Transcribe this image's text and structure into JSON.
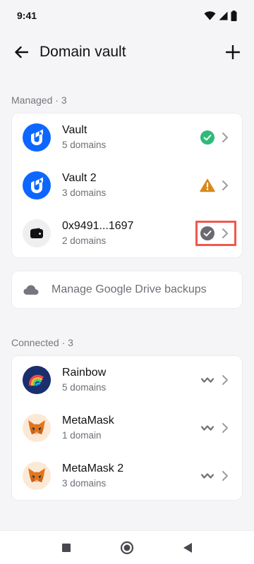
{
  "status_bar": {
    "time": "9:41"
  },
  "header": {
    "title": "Domain vault"
  },
  "managed": {
    "section_label": "Managed · 3",
    "items": [
      {
        "title": "Vault",
        "subtitle": "5 domains",
        "avatar_icon": "ud-logo-icon",
        "status_icon": "check-circle-icon",
        "status_color": "#2fba79"
      },
      {
        "title": "Vault 2",
        "subtitle": "3 domains",
        "avatar_icon": "ud-logo-icon",
        "status_icon": "warning-triangle-icon",
        "status_color": "#d9891a"
      },
      {
        "title": "0x9491...1697",
        "subtitle": "2 domains",
        "avatar_icon": "wallet-icon",
        "status_icon": "check-circle-icon",
        "status_color": "#6b6a72"
      }
    ]
  },
  "backup": {
    "label": "Manage Google Drive backups",
    "icon": "cloud-icon"
  },
  "connected": {
    "section_label": "Connected · 3",
    "items": [
      {
        "title": "Rainbow",
        "subtitle": "5 domains",
        "avatar_icon": "rainbow-logo-icon",
        "status_icon": "walletconnect-icon"
      },
      {
        "title": "MetaMask",
        "subtitle": "1 domain",
        "avatar_icon": "metamask-fox-icon",
        "status_icon": "walletconnect-icon"
      },
      {
        "title": "MetaMask 2",
        "subtitle": "3 domains",
        "avatar_icon": "metamask-fox-icon",
        "status_icon": "walletconnect-icon"
      }
    ]
  },
  "colors": {
    "ud_blue": "#0d67fe",
    "accent_highlight": "#f0584f",
    "background": "#f5f5f7"
  }
}
